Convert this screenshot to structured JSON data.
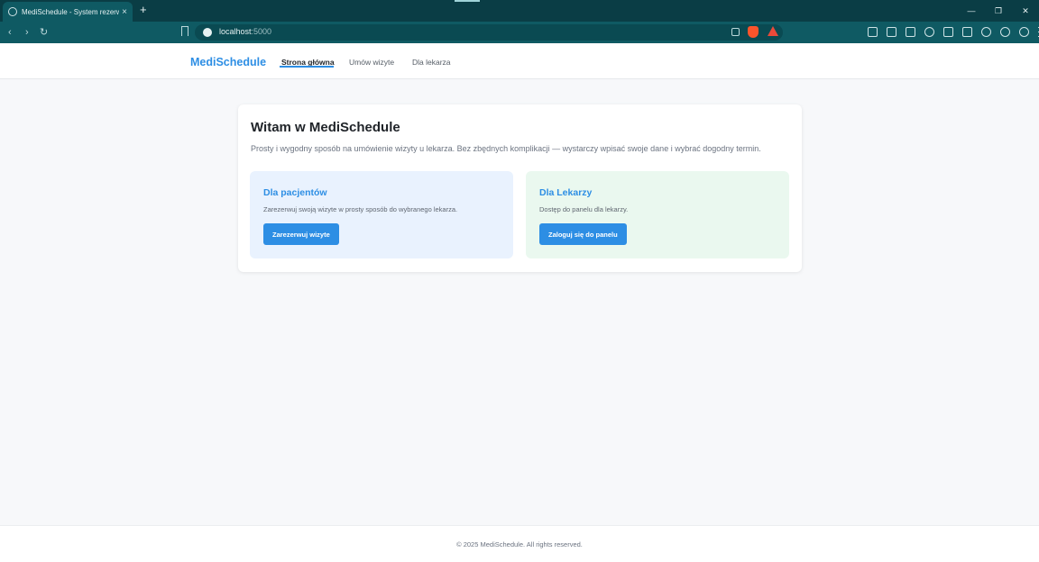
{
  "browser": {
    "tab_title": "MediSchedule - System rezerwa",
    "tab_close": "×",
    "new_tab": "+",
    "url_host": "localhost",
    "url_port": ":5000",
    "window_controls": {
      "minimize": "—",
      "restore": "❐",
      "close": "✕"
    },
    "nav": {
      "back": "‹",
      "forward": "›",
      "reload": "↻"
    }
  },
  "header": {
    "brand": "MediSchedule",
    "nav": [
      {
        "label": "Strona główna",
        "active": true
      },
      {
        "label": "Umów wizyte",
        "active": false
      },
      {
        "label": "Dla lekarza",
        "active": false
      }
    ]
  },
  "main": {
    "title": "Witam w MediSchedule",
    "description": "Prosty i wygodny sposób na umówienie wizyty u lekarza. Bez zbędnych komplikacji — wystarczy wpisać swoje dane i wybrać dogodny termin.",
    "panels": [
      {
        "title": "Dla pacjentów",
        "text": "Zarezerwuj swoją wizyte w prosty sposób do wybranego lekarza.",
        "button": "Zarezerwuj wizyte"
      },
      {
        "title": "Dla Lekarzy",
        "text": "Dostęp do panelu dla lekarzy.",
        "button": "Zaloguj się do panelu"
      }
    ]
  },
  "footer": {
    "text": "© 2025 MediSchedule. All rights reserved."
  },
  "colors": {
    "brand": "#2d8ee4",
    "browser_frame": "#0a3d45",
    "patients_panel": "#e9f2fe",
    "doctors_panel": "#eaf8ef"
  }
}
